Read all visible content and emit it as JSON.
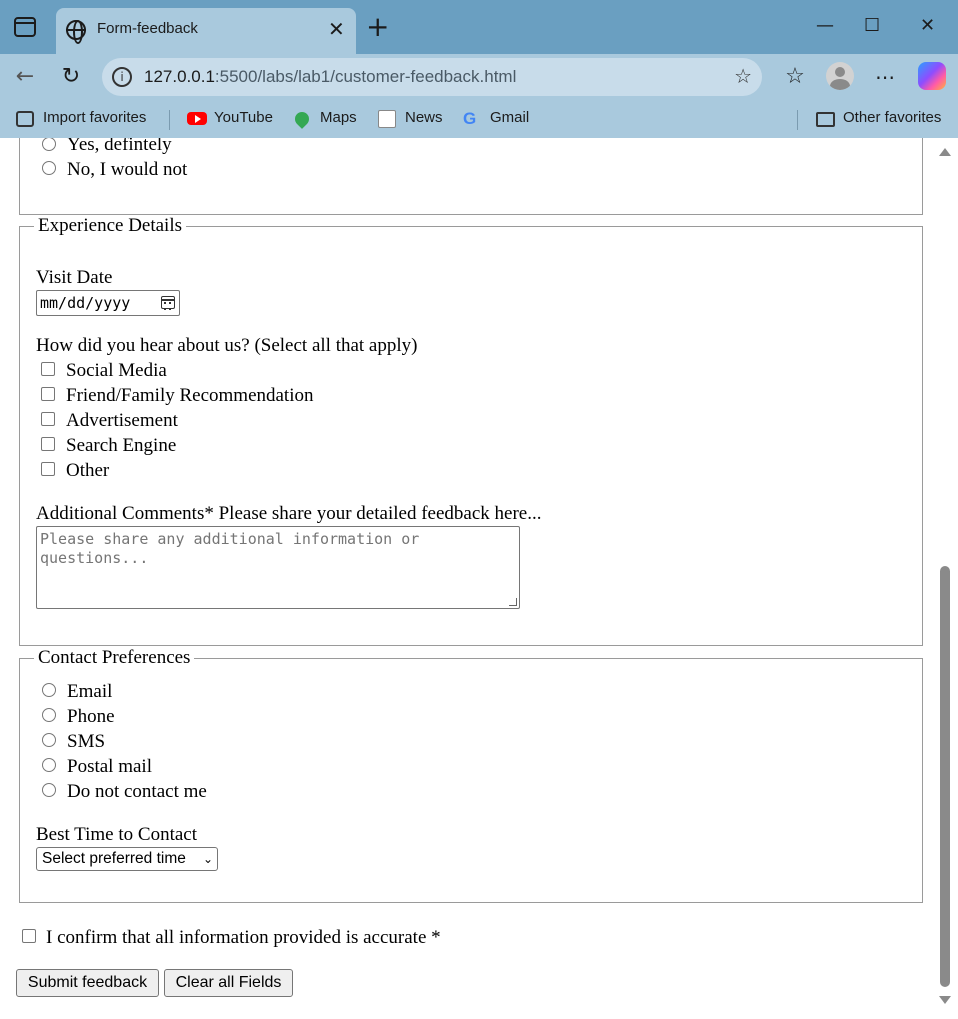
{
  "browser": {
    "tab_title": "Form-feedback",
    "tab_close": "✕",
    "new_tab": "+",
    "address_host": "127.0.0.1",
    "address_path": ":5500/labs/lab1/customer-feedback.html",
    "favorites": {
      "import": "Import favorites",
      "youtube": "YouTube",
      "maps": "Maps",
      "news": "News",
      "gmail": "Gmail",
      "other": "Other favorites"
    }
  },
  "recommend": {
    "options": [
      "Yes, defintely",
      "No, I would not"
    ]
  },
  "experience": {
    "legend": "Experience Details",
    "visit_date_label": "Visit Date",
    "visit_date_placeholder": "mm/dd/yyyy",
    "hear_label": "How did you hear about us? (Select all that apply)",
    "hear_options": [
      "Social Media",
      "Friend/Family Recommendation",
      "Advertisement",
      "Search Engine",
      "Other"
    ],
    "comments_label": "Additional Comments* Please share your detailed feedback here...",
    "comments_placeholder": "Please share any additional information or questions..."
  },
  "contact": {
    "legend": "Contact Preferences",
    "options": [
      "Email",
      "Phone",
      "SMS",
      "Postal mail",
      "Do not contact me"
    ],
    "best_time_label": "Best Time to Contact",
    "best_time_selected": "Select preferred time"
  },
  "confirm_label": "I confirm that all information provided is accurate *",
  "buttons": {
    "submit": "Submit feedback",
    "clear": "Clear all Fields"
  }
}
